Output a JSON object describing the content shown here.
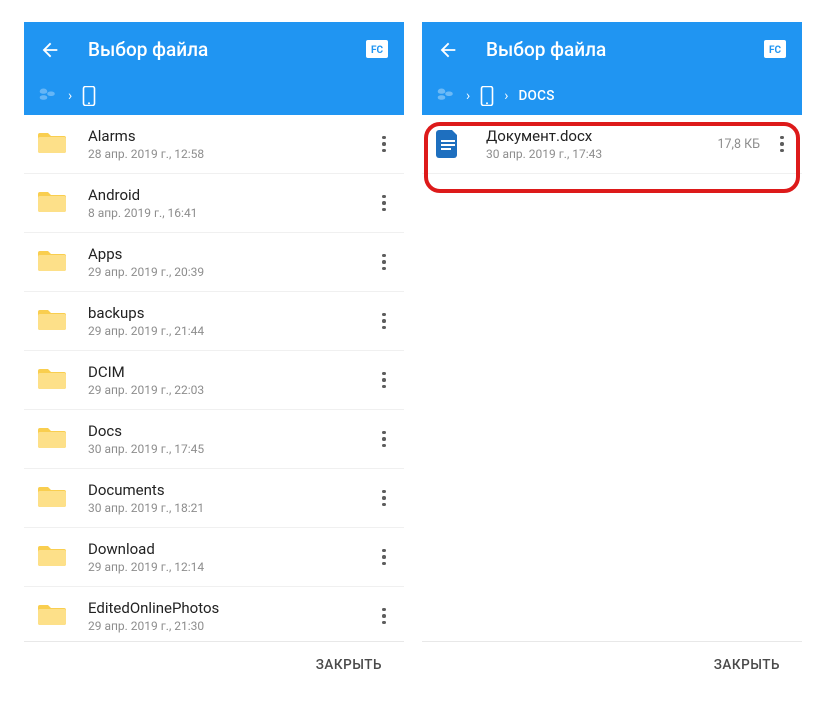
{
  "left": {
    "title": "Выбор файла",
    "breadcrumb": {
      "segments": []
    },
    "items": [
      {
        "name": "Alarms",
        "meta": "28 апр. 2019 г., 12:58",
        "type": "folder"
      },
      {
        "name": "Android",
        "meta": "8 апр. 2019 г., 16:41",
        "type": "folder"
      },
      {
        "name": "Apps",
        "meta": "29 апр. 2019 г., 20:39",
        "type": "folder"
      },
      {
        "name": "backups",
        "meta": "29 апр. 2019 г., 21:44",
        "type": "folder"
      },
      {
        "name": "DCIM",
        "meta": "29 апр. 2019 г., 22:03",
        "type": "folder"
      },
      {
        "name": "Docs",
        "meta": "30 апр. 2019 г., 17:45",
        "type": "folder"
      },
      {
        "name": "Documents",
        "meta": "30 апр. 2019 г., 18:21",
        "type": "folder"
      },
      {
        "name": "Download",
        "meta": "29 апр. 2019 г., 12:14",
        "type": "folder"
      },
      {
        "name": "EditedOnlinePhotos",
        "meta": "29 апр. 2019 г., 21:30",
        "type": "folder"
      }
    ],
    "footer": {
      "close": "ЗАКРЫТЬ"
    }
  },
  "right": {
    "title": "Выбор файла",
    "breadcrumb": {
      "label": "DOCS"
    },
    "items": [
      {
        "name": "Документ.docx",
        "meta": "30 апр. 2019 г., 17:43",
        "size": "17,8 КБ",
        "type": "docx"
      }
    ],
    "footer": {
      "close": "ЗАКРЫТЬ"
    }
  }
}
